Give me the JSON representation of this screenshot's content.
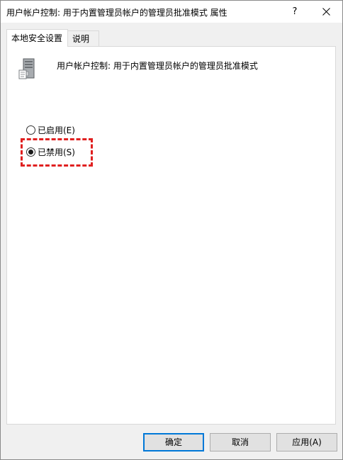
{
  "window": {
    "title": "用户帐户控制: 用于内置管理员帐户的管理员批准模式 属性",
    "help_label": "?",
    "close_icon": "close-icon"
  },
  "tabs": [
    {
      "label": "本地安全设置",
      "active": true
    },
    {
      "label": "说明",
      "active": false
    }
  ],
  "policy": {
    "icon": "server-policy-icon",
    "title": "用户帐户控制: 用于内置管理员帐户的管理员批准模式"
  },
  "options": [
    {
      "label": "已启用(E)",
      "checked": false
    },
    {
      "label": "已禁用(S)",
      "checked": true
    }
  ],
  "annotation": {
    "color": "#e02020",
    "target": "disabled-option"
  },
  "buttons": {
    "ok": "确定",
    "cancel": "取消",
    "apply": "应用(A)"
  },
  "colors": {
    "accent": "#0078d7",
    "highlight": "#e02020"
  }
}
